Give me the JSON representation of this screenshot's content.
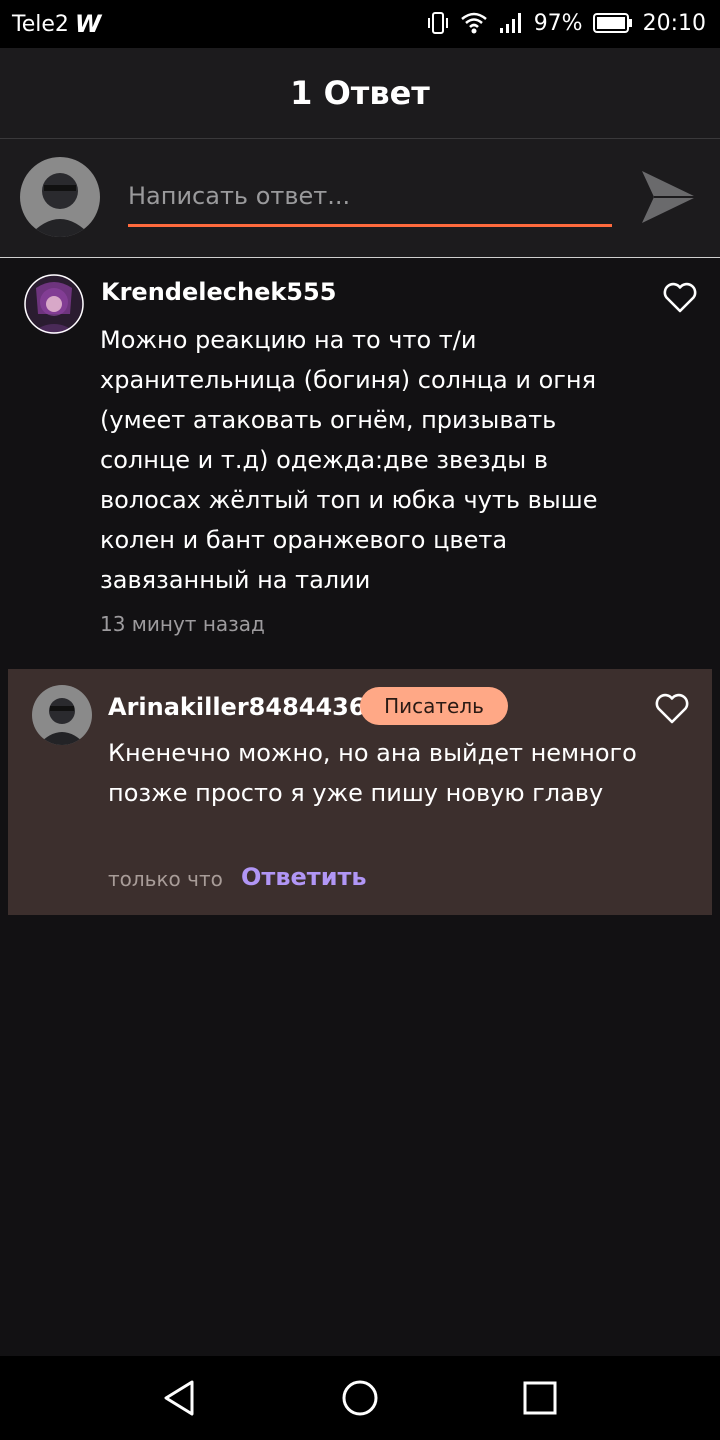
{
  "status_bar": {
    "carrier": "Tele2",
    "carrier_logo": "W",
    "battery": "97%",
    "time": "20:10",
    "icons": [
      "vibrate-icon",
      "wifi-icon",
      "signal-icon",
      "battery-icon"
    ]
  },
  "header": {
    "title": "1 Ответ"
  },
  "reply_input": {
    "placeholder": "Написать ответ...",
    "value": "",
    "accent_color": "#ff6a3d",
    "send_icon": "send-icon"
  },
  "comment": {
    "author": "Krendelechek555",
    "text": "Можно реакцию на то что т/и хранительница (богиня) солнца и огня (умеет атаковать огнём, призывать солнце и т.д) одежда:две звезды в волосах жёлтый топ и юбка чуть выше колен и бант оранжевого цвета завязанный на талии",
    "time": "13 минут назад",
    "like_icon": "heart-outline-icon"
  },
  "reply": {
    "author": "Arinakiller8484436",
    "badge": "Писатель",
    "text": "Кненечно можно, но ана выйдет немного позже просто я уже пишу новую главу",
    "time": "только что",
    "reply_label": "Ответить",
    "like_icon": "heart-outline-icon",
    "badge_color": "#ffa886",
    "link_color": "#b196f5",
    "card_color": "#3c2f2d"
  },
  "nav_bar": {
    "icons": [
      "back-triangle-icon",
      "home-circle-icon",
      "recents-square-icon"
    ]
  }
}
